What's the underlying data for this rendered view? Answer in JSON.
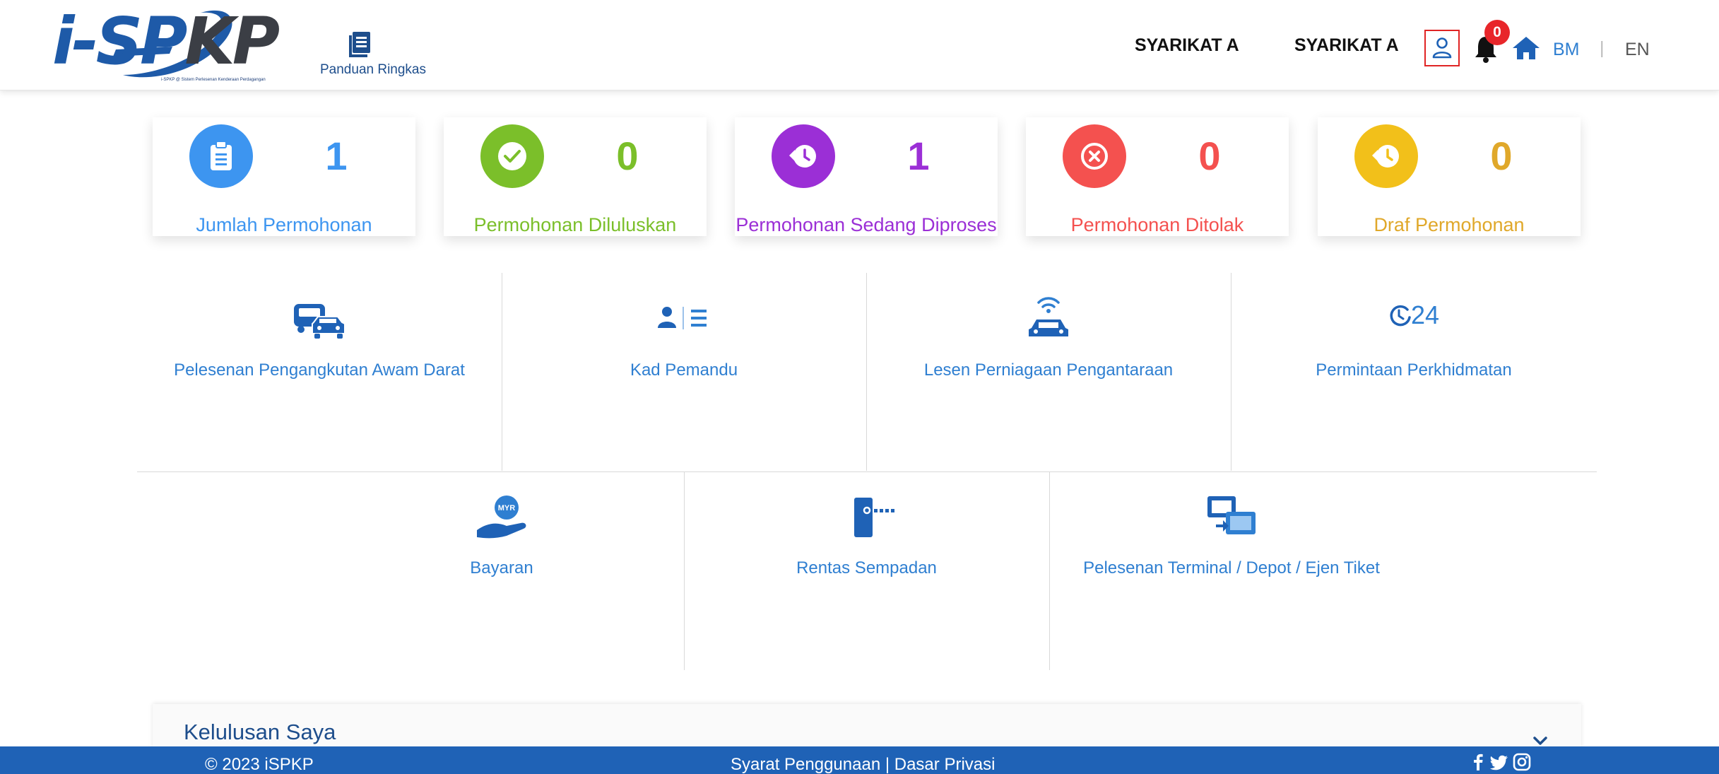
{
  "header": {
    "logo_text_prefix": "i-SP",
    "logo_text_suffix": "KP",
    "logo_tagline": "i-SPKP @ Sistem Perlesenan Kenderaan Perdagangan",
    "guide_label": "Panduan Ringkas",
    "company_1": "SYARIKAT A",
    "company_2": "SYARIKAT A",
    "notification_count": "0",
    "lang_bm": "BM",
    "lang_sep": "|",
    "lang_en": "EN",
    "icons": [
      "book-icon",
      "user-icon",
      "bell-icon",
      "home-icon"
    ],
    "active_lang_color": "#2f7fd1"
  },
  "stats": [
    {
      "count": "1",
      "label": "Jumlah Permohonan",
      "color": "#3d95f0",
      "icon": "clipboard-icon"
    },
    {
      "count": "0",
      "label": "Permohonan Diluluskan",
      "color": "#7bbf2a",
      "icon": "check-icon"
    },
    {
      "count": "1",
      "label": "Permohonan Sedang Diproses",
      "color": "#9b2fd6",
      "icon": "history-icon"
    },
    {
      "count": "0",
      "label": "Permohonan Ditolak",
      "color": "#f4514f",
      "icon": "cancel-icon"
    },
    {
      "count": "0",
      "label": "Draf Permohonan",
      "color": "#f2c01a",
      "icon": "history-icon"
    }
  ],
  "services": [
    {
      "label": "Pelesenan Pengangkutan Awam Darat",
      "icon": "bus-car-icon"
    },
    {
      "label": "Kad Pemandu",
      "icon": "driver-card-icon"
    },
    {
      "label": "Lesen Perniagaan Pengantaraan",
      "icon": "connected-car-icon"
    },
    {
      "label": "Permintaan Perkhidmatan",
      "icon": "service-24-icon",
      "icon_text": "24"
    },
    {
      "label": "Bayaran",
      "icon": "payment-hand-icon",
      "icon_text": "MYR"
    },
    {
      "label": "Rentas Sempadan",
      "icon": "border-crossing-icon"
    },
    {
      "label": "Pelesenan Terminal / Depot / Ejen Tiket",
      "icon": "terminal-icon"
    }
  ],
  "approval": {
    "title": "Kelulusan Saya",
    "icon": "chevron-down-icon"
  },
  "footer": {
    "copyright": "© 2023 iSPKP",
    "terms": "Syarat Penggunaan",
    "sep": "|",
    "privacy": "Dasar Privasi",
    "social": [
      "facebook-icon",
      "twitter-icon",
      "instagram-icon"
    ]
  },
  "colors": {
    "primary": "#1f62b6",
    "link": "#2f7fd1",
    "dark_blue": "#1e4e8c",
    "alert": "#e02424"
  }
}
